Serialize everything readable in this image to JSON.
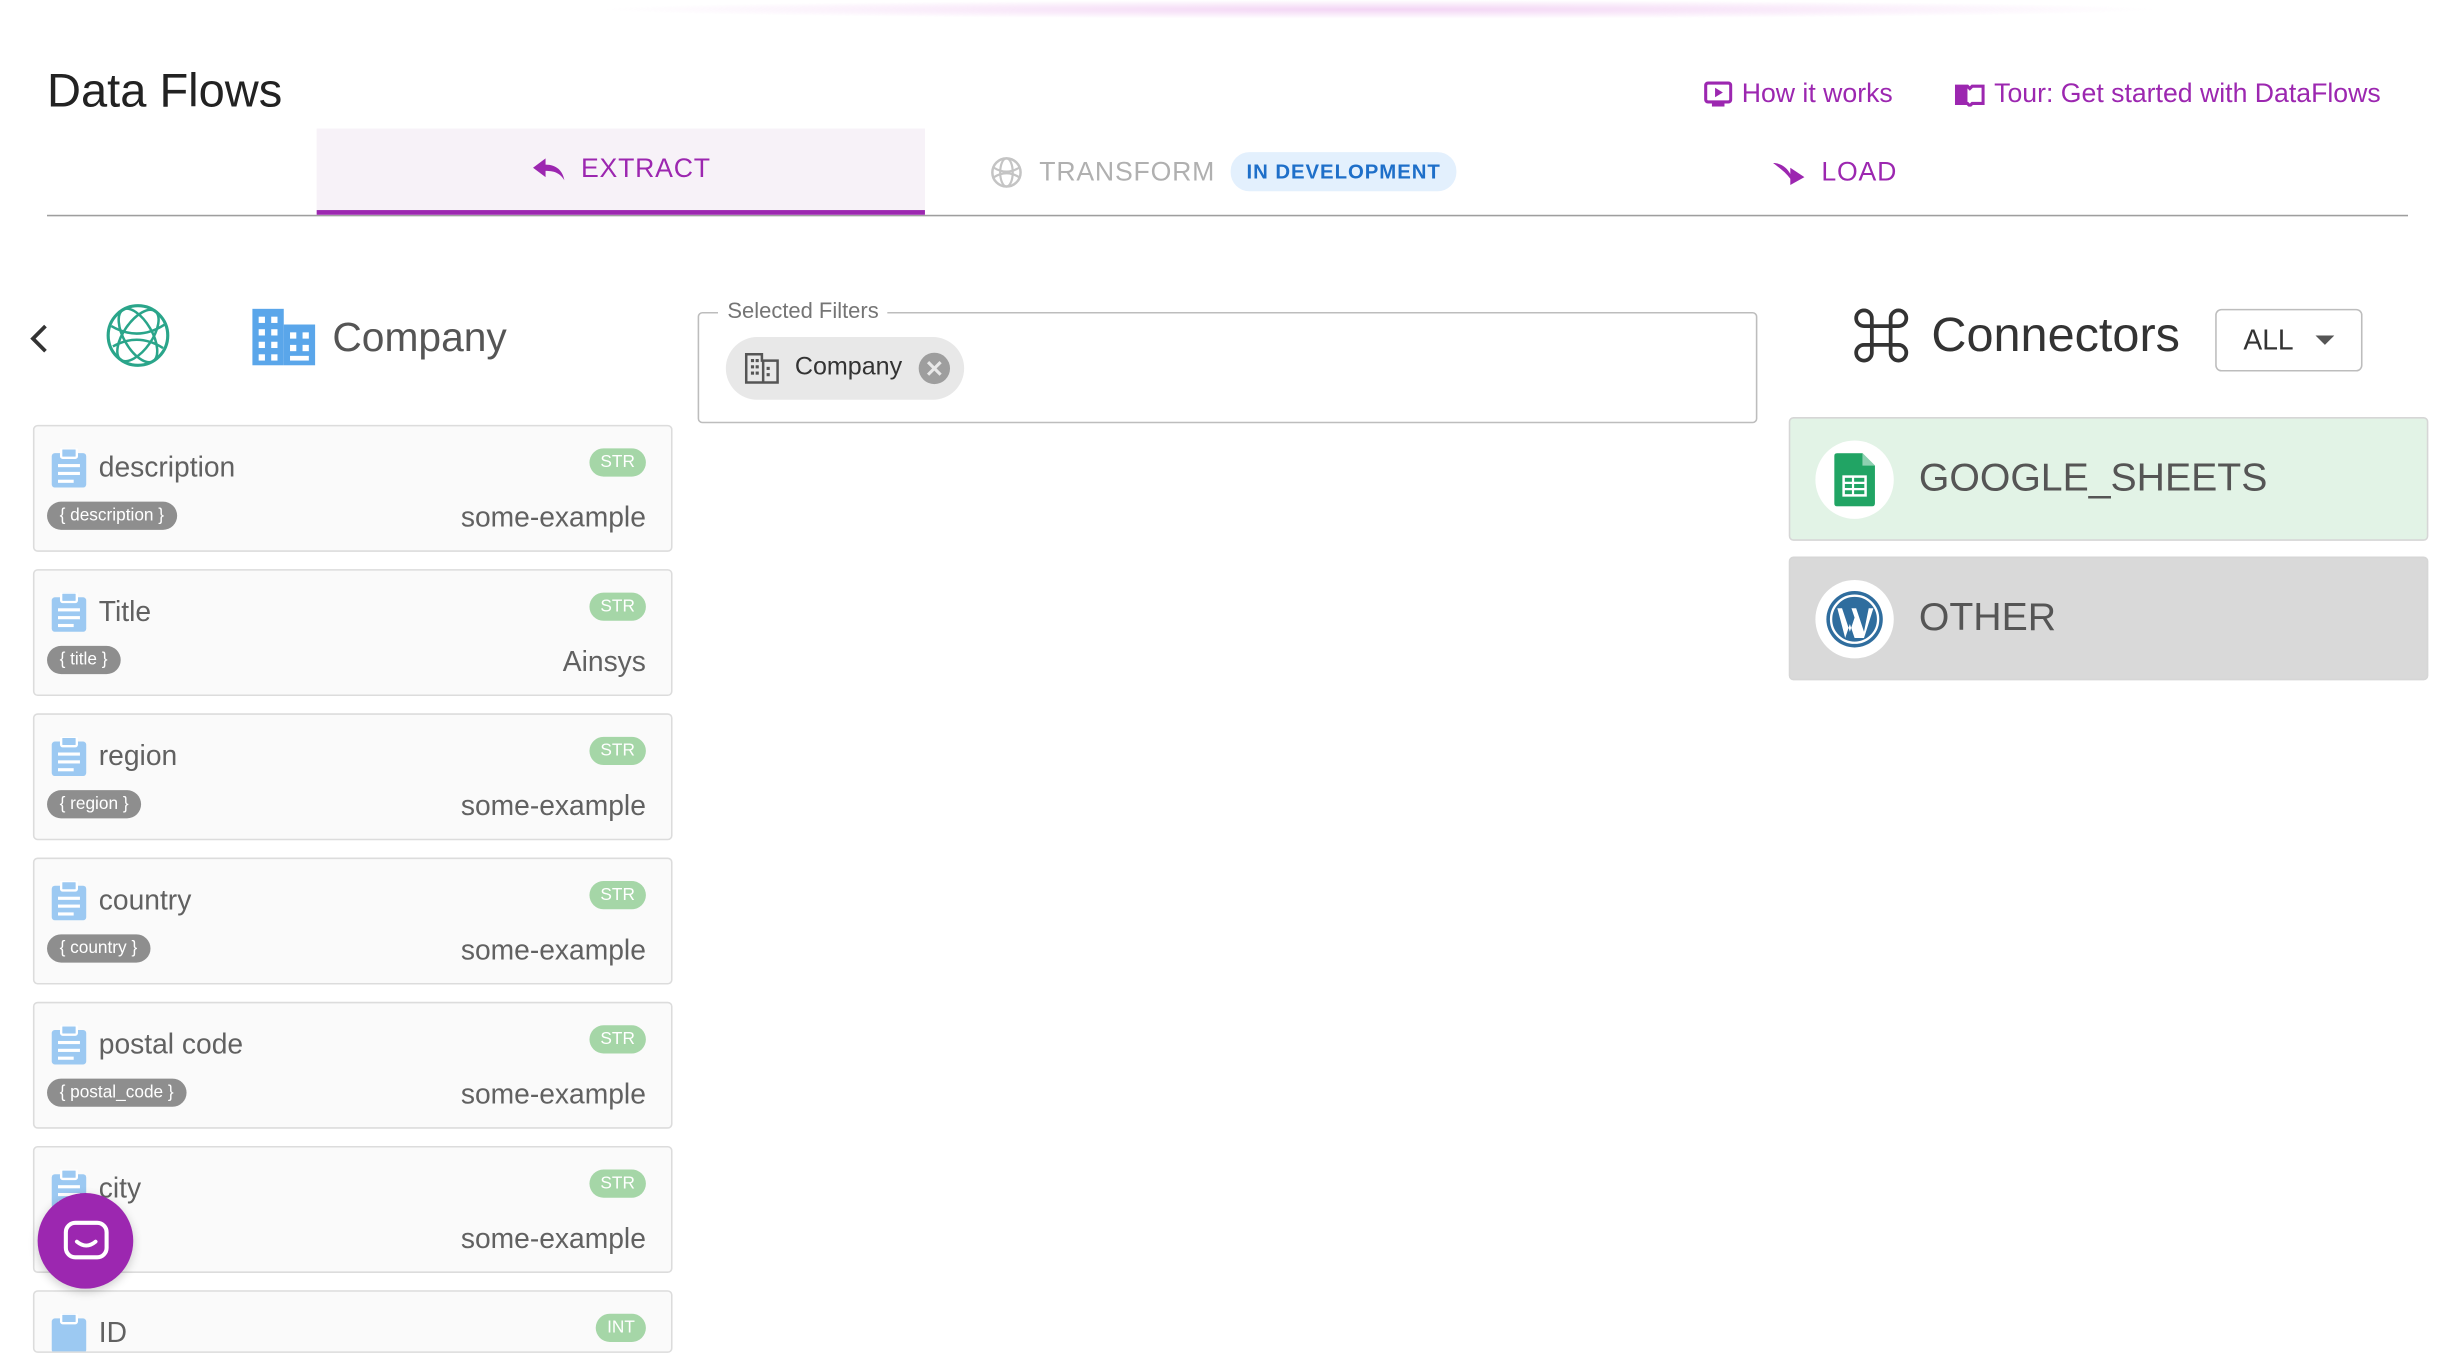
{
  "header": {
    "title": "Data Flows",
    "how_it_works": "How it works",
    "tour": "Tour: Get started with DataFlows"
  },
  "tabs": {
    "extract": "EXTRACT",
    "transform": "TRANSFORM",
    "transform_badge": "IN DEVELOPMENT",
    "load": "LOAD"
  },
  "entity": {
    "name": "Company"
  },
  "fields": [
    {
      "name": "description",
      "key": "{ description }",
      "type": "STR",
      "example": "some-example"
    },
    {
      "name": "Title",
      "key": "{ title }",
      "type": "STR",
      "example": "Ainsys"
    },
    {
      "name": "region",
      "key": "{ region }",
      "type": "STR",
      "example": "some-example"
    },
    {
      "name": "country",
      "key": "{ country }",
      "type": "STR",
      "example": "some-example"
    },
    {
      "name": "postal code",
      "key": "{ postal_code }",
      "type": "STR",
      "example": "some-example"
    },
    {
      "name": "city",
      "key": "",
      "type": "STR",
      "example": "some-example"
    },
    {
      "name": "ID",
      "key": "",
      "type": "INT",
      "example": ""
    }
  ],
  "filters": {
    "legend": "Selected Filters",
    "chips": [
      "Company"
    ]
  },
  "connectors": {
    "title": "Connectors",
    "select_value": "ALL",
    "items": [
      {
        "label": "GOOGLE_SHEETS",
        "icon": "google-sheets-icon"
      },
      {
        "label": "OTHER",
        "icon": "wordpress-icon"
      }
    ]
  },
  "colors": {
    "accent": "#9c27b0",
    "badge_blue": "#1e6fc9",
    "type_green": "#a5d6a7",
    "connector_green": "#e2f3e6"
  }
}
